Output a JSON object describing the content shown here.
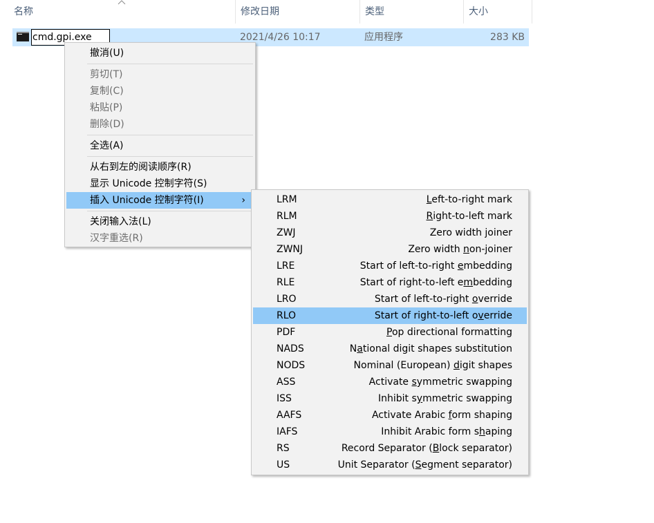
{
  "columns": {
    "name": "名称",
    "modified": "修改日期",
    "type": "类型",
    "size": "大小"
  },
  "file": {
    "icon": "console-app-icon",
    "rename_value": "cmd.gpi.exe",
    "modified": "2021/4/26 10:17",
    "type": "应用程序",
    "size": "283 KB"
  },
  "context_menu": {
    "undo": "撤消(U)",
    "cut": "剪切(T)",
    "copy": "复制(C)",
    "paste": "粘贴(P)",
    "delete": "删除(D)",
    "select_all": "全选(A)",
    "rtl_order": "从右到左的阅读顺序(R)",
    "show_unicode": "显示 Unicode 控制字符(S)",
    "insert_unicode": "插入 Unicode 控制字符(I)",
    "submenu_arrow": "›",
    "close_ime": "关闭输入法(L)",
    "reconvert": "汉字重选(R)"
  },
  "unicode_submenu": [
    {
      "code": "LRM",
      "pre": "",
      "key": "L",
      "post": "eft-to-right mark"
    },
    {
      "code": "RLM",
      "pre": "",
      "key": "R",
      "post": "ight-to-left mark"
    },
    {
      "code": "ZWJ",
      "pre": "Zero width ",
      "key": "j",
      "post": "oiner"
    },
    {
      "code": "ZWNJ",
      "pre": "Zero width ",
      "key": "n",
      "post": "on-joiner"
    },
    {
      "code": "LRE",
      "pre": "Start of left-to-right ",
      "key": "e",
      "post": "mbedding"
    },
    {
      "code": "RLE",
      "pre": "Start of right-to-left e",
      "key": "m",
      "post": "bedding"
    },
    {
      "code": "LRO",
      "pre": "Start of left-to-right ",
      "key": "o",
      "post": "verride"
    },
    {
      "code": "RLO",
      "pre": "Start of right-to-left o",
      "key": "v",
      "post": "erride"
    },
    {
      "code": "PDF",
      "pre": "",
      "key": "P",
      "post": "op directional formatting"
    },
    {
      "code": "NADS",
      "pre": "N",
      "key": "a",
      "post": "tional digit shapes substitution"
    },
    {
      "code": "NODS",
      "pre": "Nominal (European) ",
      "key": "d",
      "post": "igit shapes"
    },
    {
      "code": "ASS",
      "pre": "Activate ",
      "key": "s",
      "post": "ymmetric swapping"
    },
    {
      "code": "ISS",
      "pre": "Inhibit s",
      "key": "y",
      "post": "mmetric swapping"
    },
    {
      "code": "AAFS",
      "pre": "Activate Arabic ",
      "key": "f",
      "post": "orm shaping"
    },
    {
      "code": "IAFS",
      "pre": "Inhibit Arabic form s",
      "key": "h",
      "post": "aping"
    },
    {
      "code": "RS",
      "pre": "Record Separator (",
      "key": "B",
      "post": "lock separator)"
    },
    {
      "code": "US",
      "pre": "Unit Separator (",
      "key": "S",
      "post": "egment separator)"
    }
  ],
  "highlighted_submenu_index": 7,
  "colors": {
    "selection": "#cce8ff",
    "menu_highlight": "#91c9f7",
    "menu_bg": "#f2f2f2",
    "header_text": "#4c607a"
  }
}
